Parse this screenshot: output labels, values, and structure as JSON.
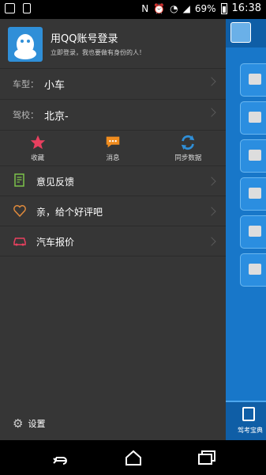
{
  "status_bar": {
    "battery": "69%",
    "time": "16:38"
  },
  "drawer": {
    "login": {
      "title": "用QQ账号登录",
      "subtitle": "立即登录，我也要做有身份的人！"
    },
    "car_type": {
      "key": "车型：",
      "value": "小车"
    },
    "school": {
      "key": "驾校：",
      "value": "北京-"
    },
    "quick_actions": [
      {
        "label": "收藏",
        "icon": "star-icon",
        "color": "#e8405f"
      },
      {
        "label": "消息",
        "icon": "message-icon",
        "color": "#f08c1e"
      },
      {
        "label": "同步数据",
        "icon": "sync-icon",
        "color": "#2f8fd8"
      }
    ],
    "menu": [
      {
        "label": "意见反馈",
        "icon": "feedback-icon",
        "color": "#7cc24a"
      },
      {
        "label": "亲，给个好评吧",
        "icon": "heart-icon",
        "color": "#e08a3c"
      },
      {
        "label": "汽车报价",
        "icon": "car-icon",
        "color": "#e8405f"
      }
    ],
    "settings_label": "设置"
  },
  "main": {
    "bottom_tab_label": "驾考宝典"
  },
  "colors": {
    "drawer_bg": "#363636",
    "main_blue": "#1877c9"
  }
}
